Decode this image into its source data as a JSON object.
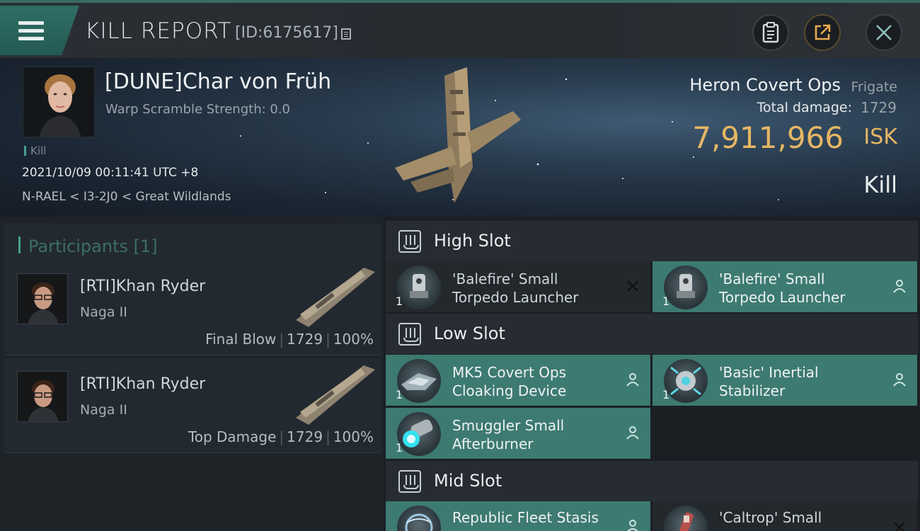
{
  "header": {
    "title": "KILL REPORT",
    "report_id": "[ID:6175617]"
  },
  "victim": {
    "name": "[DUNE]Char von Früh",
    "warp_scramble": "Warp Scramble Strength: 0.0",
    "kill_tag": "Kill",
    "datetime": "2021/10/09 00:11:41 UTC +8",
    "location": "N-RAEL < I3-2J0 < Great Wildlands",
    "ship_name": "Heron Covert Ops",
    "ship_class": "Frigate",
    "total_damage_label": "Total damage:",
    "total_damage": "1729",
    "isk_value": "7,911,966",
    "isk_unit": "ISK",
    "result": "Kill"
  },
  "participants": {
    "title": "Participants [1]",
    "items": [
      {
        "name": "[RTI]Khan Ryder",
        "ship": "Naga II",
        "role": "Final Blow",
        "damage": "1729",
        "percent": "100%"
      },
      {
        "name": "[RTI]Khan Ryder",
        "ship": "Naga II",
        "role": "Top Damage",
        "damage": "1729",
        "percent": "100%"
      }
    ]
  },
  "slots": {
    "high": {
      "title": "High Slot",
      "modules": [
        {
          "name_line1": "'Balefire' Small",
          "name_line2": "Torpedo Launcher",
          "qty": "1",
          "status": "destroyed-x-icon"
        },
        {
          "name_line1": "'Balefire' Small",
          "name_line2": "Torpedo Launcher",
          "qty": "1",
          "status": "dropped-person-icon"
        }
      ]
    },
    "low": {
      "title": "Low Slot",
      "modules": [
        {
          "name_line1": "MK5 Covert Ops",
          "name_line2": "Cloaking Device",
          "qty": "1",
          "status": "dropped-person-icon"
        },
        {
          "name_line1": "'Basic' Inertial",
          "name_line2": "Stabilizer",
          "qty": "1",
          "status": "dropped-person-icon"
        },
        {
          "name_line1": "Smuggler Small",
          "name_line2": "Afterburner",
          "qty": "1",
          "status": "dropped-person-icon"
        }
      ]
    },
    "mid": {
      "title": "Mid Slot",
      "modules": [
        {
          "name_line1": "Republic Fleet Stasis",
          "qty": "",
          "status": "dropped-person-icon"
        },
        {
          "name_line1": "'Caltrop' Small",
          "qty": "",
          "status": "destroyed-x-icon"
        }
      ]
    }
  },
  "colors": {
    "accent_teal": "#3d7a72",
    "isk_gold": "#e6b664",
    "header_bar": "#3a6b63"
  }
}
